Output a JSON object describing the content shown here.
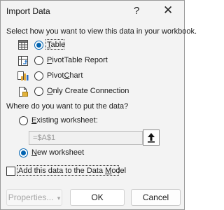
{
  "dialog": {
    "title": "Import Data",
    "help_glyph": "?",
    "close_glyph": "✕"
  },
  "view_section": {
    "heading": "Select how you want to view this data in your workbook.",
    "options": [
      {
        "label_pre": "",
        "label_u": "T",
        "label_post": "able",
        "selected": true,
        "icon": "table-icon"
      },
      {
        "label_pre": "",
        "label_u": "P",
        "label_post": "ivotTable Report",
        "selected": false,
        "icon": "pivottable-icon"
      },
      {
        "label_pre": "Pivot",
        "label_u": "C",
        "label_post": "hart",
        "selected": false,
        "icon": "pivotchart-icon"
      },
      {
        "label_pre": "",
        "label_u": "O",
        "label_post": "nly Create Connection",
        "selected": false,
        "icon": "connection-icon"
      }
    ]
  },
  "location_section": {
    "heading": "Where do you want to put the data?",
    "existing_pre": "",
    "existing_u": "E",
    "existing_post": "xisting worksheet:",
    "existing_selected": false,
    "cell_value": "=$A$1",
    "ref_button_glyph": "🡅",
    "new_pre": "",
    "new_u": "N",
    "new_post": "ew worksheet",
    "new_selected": true
  },
  "data_model": {
    "label_pre": "Add this data to the Data ",
    "label_u": "M",
    "label_post": "odel",
    "checked": false
  },
  "buttons": {
    "properties_label": "Properties...",
    "properties_arrow": "▾",
    "ok_label": "OK",
    "cancel_label": "Cancel"
  },
  "colors": {
    "accent": "#0063b1",
    "background": "#f3f3f3"
  }
}
